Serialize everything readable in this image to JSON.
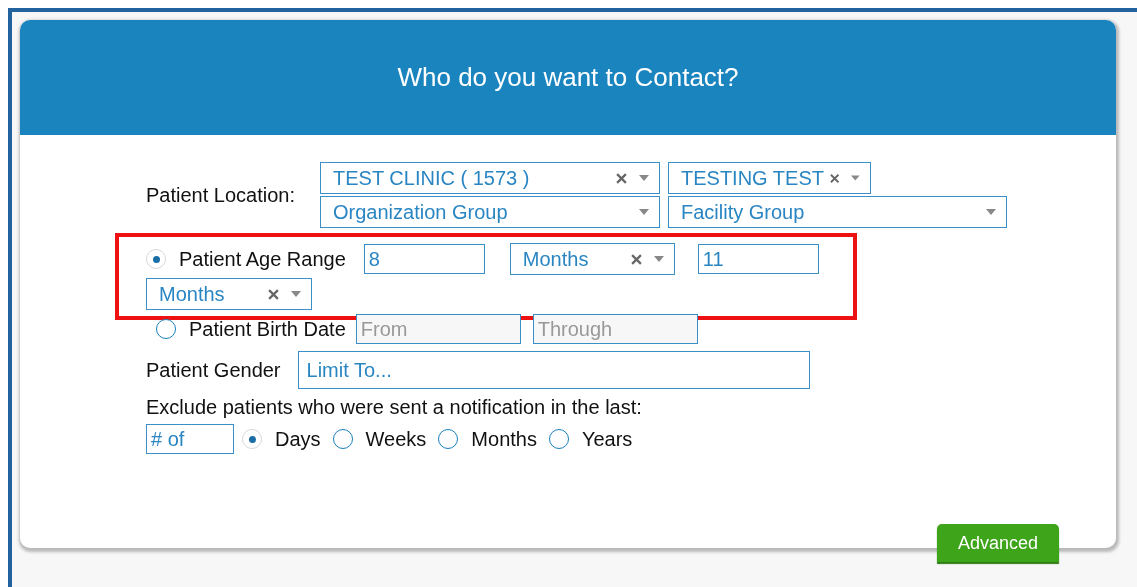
{
  "header": {
    "title": "Who do you want to Contact?"
  },
  "location": {
    "label": "Patient Location:",
    "selects": [
      {
        "value": "TEST CLINIC ( 1573 )",
        "clearable": true
      },
      {
        "value": "TESTING TEST",
        "clearable": true
      },
      {
        "placeholder": "Organization Group",
        "clearable": false
      },
      {
        "placeholder": "Facility Group",
        "clearable": false
      }
    ]
  },
  "age_range": {
    "label": "Patient Age Range",
    "selected": true,
    "from": "8",
    "from_unit": {
      "value": "Months",
      "clearable": true
    },
    "to": "11",
    "to_unit": {
      "value": "Months",
      "clearable": true
    }
  },
  "birth_date": {
    "label": "Patient Birth Date",
    "selected": false,
    "disabled": true,
    "from_placeholder": "From",
    "through_placeholder": "Through"
  },
  "gender": {
    "label": "Patient Gender",
    "placeholder": "Limit To..."
  },
  "exclude": {
    "label": "Exclude patients who were sent a notification in the last:",
    "count_placeholder": "# of",
    "units": [
      {
        "label": "Days",
        "selected": true
      },
      {
        "label": "Weeks",
        "selected": false
      },
      {
        "label": "Months",
        "selected": false
      },
      {
        "label": "Years",
        "selected": false
      }
    ]
  },
  "advanced_button": "Advanced"
}
